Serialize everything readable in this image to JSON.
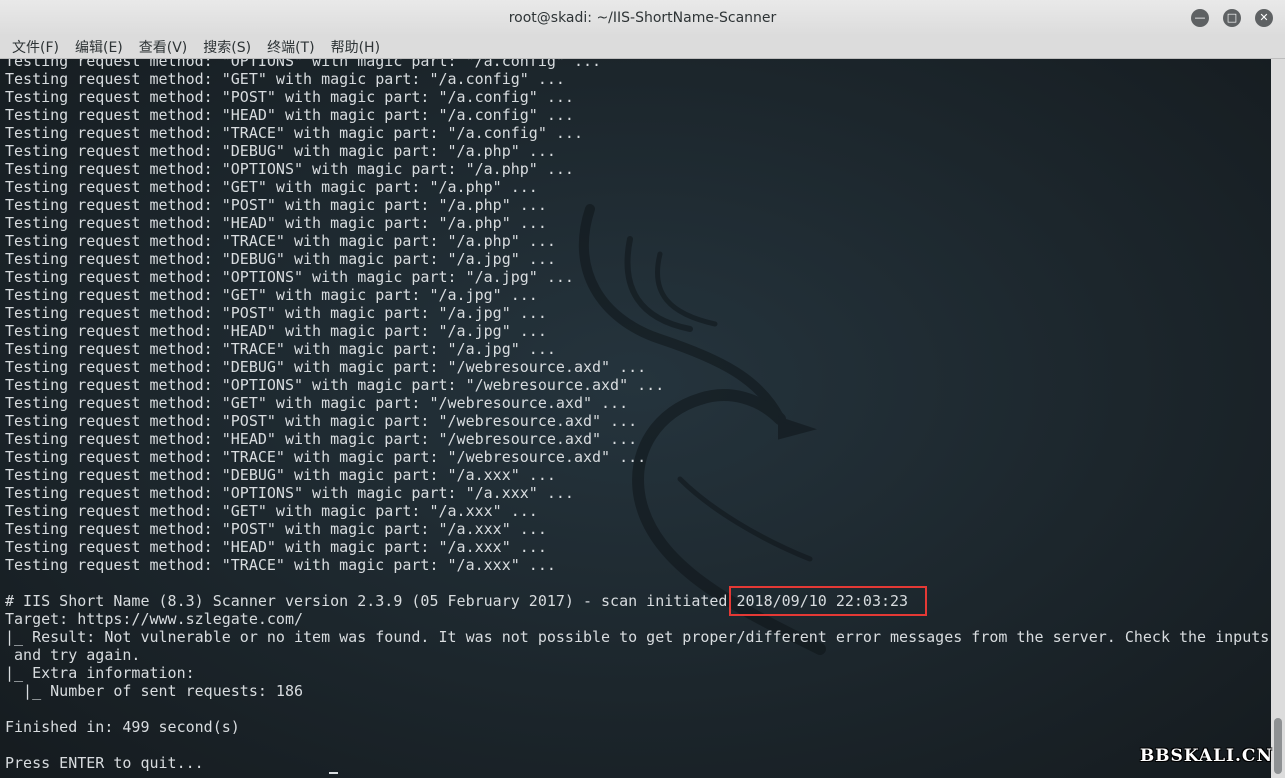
{
  "window": {
    "title": "root@skadi: ~/IIS-ShortName-Scanner"
  },
  "menu": {
    "items": [
      "文件(F)",
      "编辑(E)",
      "查看(V)",
      "搜索(S)",
      "终端(T)",
      "帮助(H)"
    ]
  },
  "terminal": {
    "lines": [
      "Testing request method: \"OPTIONS\" with magic part: \"/a.config\" ...",
      "Testing request method: \"GET\" with magic part: \"/a.config\" ...",
      "Testing request method: \"POST\" with magic part: \"/a.config\" ...",
      "Testing request method: \"HEAD\" with magic part: \"/a.config\" ...",
      "Testing request method: \"TRACE\" with magic part: \"/a.config\" ...",
      "Testing request method: \"DEBUG\" with magic part: \"/a.php\" ...",
      "Testing request method: \"OPTIONS\" with magic part: \"/a.php\" ...",
      "Testing request method: \"GET\" with magic part: \"/a.php\" ...",
      "Testing request method: \"POST\" with magic part: \"/a.php\" ...",
      "Testing request method: \"HEAD\" with magic part: \"/a.php\" ...",
      "Testing request method: \"TRACE\" with magic part: \"/a.php\" ...",
      "Testing request method: \"DEBUG\" with magic part: \"/a.jpg\" ...",
      "Testing request method: \"OPTIONS\" with magic part: \"/a.jpg\" ...",
      "Testing request method: \"GET\" with magic part: \"/a.jpg\" ...",
      "Testing request method: \"POST\" with magic part: \"/a.jpg\" ...",
      "Testing request method: \"HEAD\" with magic part: \"/a.jpg\" ...",
      "Testing request method: \"TRACE\" with magic part: \"/a.jpg\" ...",
      "Testing request method: \"DEBUG\" with magic part: \"/webresource.axd\" ...",
      "Testing request method: \"OPTIONS\" with magic part: \"/webresource.axd\" ...",
      "Testing request method: \"GET\" with magic part: \"/webresource.axd\" ...",
      "Testing request method: \"POST\" with magic part: \"/webresource.axd\" ...",
      "Testing request method: \"HEAD\" with magic part: \"/webresource.axd\" ...",
      "Testing request method: \"TRACE\" with magic part: \"/webresource.axd\" ...",
      "Testing request method: \"DEBUG\" with magic part: \"/a.xxx\" ...",
      "Testing request method: \"OPTIONS\" with magic part: \"/a.xxx\" ...",
      "Testing request method: \"GET\" with magic part: \"/a.xxx\" ...",
      "Testing request method: \"POST\" with magic part: \"/a.xxx\" ...",
      "Testing request method: \"HEAD\" with magic part: \"/a.xxx\" ...",
      "Testing request method: \"TRACE\" with magic part: \"/a.xxx\" ...",
      "",
      "# IIS Short Name (8.3) Scanner version 2.3.9 (05 February 2017) - scan initiated 2018/09/10 22:03:23",
      "Target: https://www.szlegate.com/",
      "|_ Result: Not vulnerable or no item was found. It was not possible to get proper/different error messages from the server. Check the inputs",
      " and try again.",
      "|_ Extra information:",
      "  |_ Number of sent requests: 186",
      "",
      "Finished in: 499 second(s)",
      "",
      "Press ENTER to quit..."
    ]
  },
  "watermark": "BBSKALI.CN",
  "colors": {
    "terminal_text": "#d8dcdf",
    "highlight_border": "#e53935",
    "titlebar_bg": "#dcdcdc"
  }
}
